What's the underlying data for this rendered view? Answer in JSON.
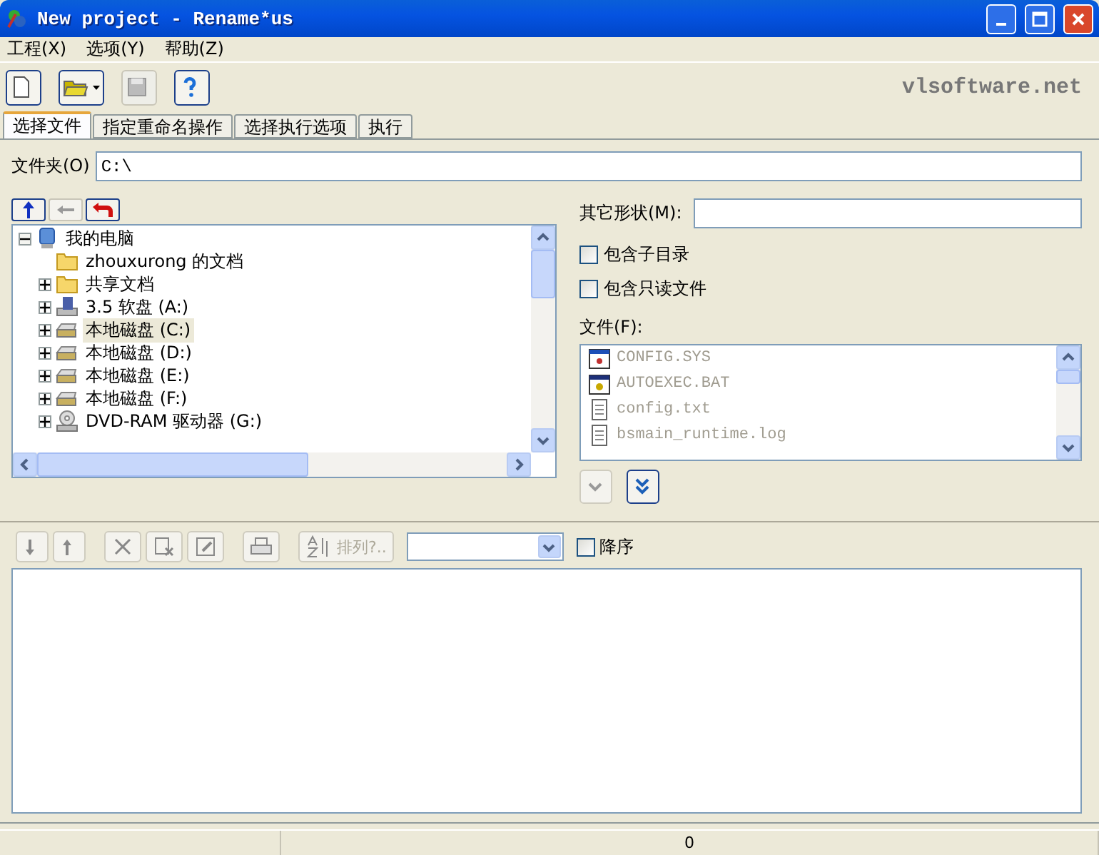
{
  "window": {
    "title": "New project - Rename*us"
  },
  "menu": [
    {
      "label": "工程(X)"
    },
    {
      "label": "选项(Y)"
    },
    {
      "label": "帮助(Z)"
    }
  ],
  "toolbar": {
    "buttons": [
      {
        "kind": "new",
        "disabled": false
      },
      {
        "kind": "open",
        "disabled": false
      },
      {
        "kind": "save",
        "disabled": true
      },
      {
        "kind": "help",
        "disabled": false
      }
    ],
    "brand": "vlsoftware.net"
  },
  "tabs": [
    {
      "label": "选择文件",
      "selected": true
    },
    {
      "label": "指定重命名操作",
      "selected": false
    },
    {
      "label": "选择执行选项",
      "selected": false
    },
    {
      "label": "执行",
      "selected": false
    }
  ],
  "folder": {
    "label": "文件夹(O)",
    "value": "C:\\"
  },
  "nav_buttons": [
    {
      "kind": "up",
      "disabled": false
    },
    {
      "kind": "back",
      "disabled": true
    },
    {
      "kind": "undo",
      "disabled": false
    }
  ],
  "tree": [
    {
      "label": "我的电脑",
      "kind": "computer",
      "expandable": true,
      "expanded": true,
      "selected": false,
      "children": [
        {
          "label": "zhouxurong 的文档",
          "kind": "folder",
          "expandable": false,
          "selected": false
        },
        {
          "label": "共享文档",
          "kind": "folder",
          "expandable": true,
          "expanded": false,
          "selected": false
        },
        {
          "label": "3.5 软盘 (A:)",
          "kind": "floppy",
          "expandable": true,
          "expanded": false,
          "selected": false
        },
        {
          "label": "本地磁盘 (C:)",
          "kind": "drive",
          "expandable": true,
          "expanded": false,
          "selected": true
        },
        {
          "label": "本地磁盘 (D:)",
          "kind": "drive",
          "expandable": true,
          "expanded": false,
          "selected": false
        },
        {
          "label": "本地磁盘 (E:)",
          "kind": "drive",
          "expandable": true,
          "expanded": false,
          "selected": false
        },
        {
          "label": "本地磁盘 (F:)",
          "kind": "drive",
          "expandable": true,
          "expanded": false,
          "selected": false
        },
        {
          "label": "DVD-RAM 驱动器 (G:)",
          "kind": "dvd",
          "expandable": true,
          "expanded": false,
          "selected": false
        }
      ]
    }
  ],
  "other_shape": {
    "label": "其它形状(M):"
  },
  "options": [
    {
      "label": "包含子目录",
      "checked": false
    },
    {
      "label": "包含只读文件",
      "checked": false
    }
  ],
  "files": {
    "label": "文件(F):",
    "items": [
      {
        "name": "CONFIG.SYS",
        "kind": "system"
      },
      {
        "name": "AUTOEXEC.BAT",
        "kind": "batch"
      },
      {
        "name": "config.txt",
        "kind": "text"
      },
      {
        "name": "bsmain_runtime.log",
        "kind": "text"
      }
    ]
  },
  "add_buttons": [
    {
      "kind": "add",
      "disabled": true
    },
    {
      "kind": "add-all",
      "disabled": false
    }
  ],
  "list_toolbar": {
    "buttons": [
      {
        "kind": "down",
        "disabled": true
      },
      {
        "kind": "up",
        "disabled": true
      },
      {
        "kind": "delete",
        "disabled": true
      },
      {
        "kind": "clear",
        "disabled": true
      },
      {
        "kind": "edit",
        "disabled": true
      },
      {
        "kind": "print",
        "disabled": true
      }
    ],
    "sort": {
      "label": "排列?..",
      "disabled": true
    },
    "descending": {
      "label": "降序",
      "checked": false
    }
  },
  "status_bar": {
    "count": "0"
  }
}
